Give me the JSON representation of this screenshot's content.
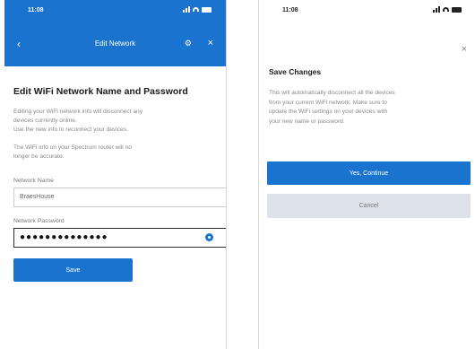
{
  "left": {
    "status": {
      "time": "11:08"
    },
    "header": {
      "title": "Edit Network",
      "back_icon": "chevron-left-icon",
      "action_icon": "wifi-settings-icon",
      "close_icon": "close-icon"
    },
    "page_title": "Edit WiFi Network Name and Password",
    "paragraph1_line1": "Editing your WiFi network info will disconnect any",
    "paragraph1_line2": "devices currently online.",
    "paragraph1_line3": "Use the new info to reconnect your devices.",
    "paragraph2_line1": "The WiFi info on your Spectrum router will no",
    "paragraph2_line2": "longer be accurate.",
    "network_name_label": "Network Name",
    "network_name_value": "BraesHouse",
    "network_password_label": "Network Password",
    "network_password_value": "●●●●●●●●●●●●●●",
    "save_label": "Save",
    "accent": "#1b73d0"
  },
  "right": {
    "status": {
      "time": "11:08"
    },
    "dialog_title": "Save Changes",
    "dialog_body_line1": "This will automatically disconnect all the devices",
    "dialog_body_line2": "from your current WiFi network. Make sure to",
    "dialog_body_line3": "update the WiFi settings on your devices with",
    "dialog_body_line4": "your new name or password.",
    "continue_label": "Yes, Continue",
    "cancel_label": "Cancel",
    "close_icon": "close-icon"
  }
}
